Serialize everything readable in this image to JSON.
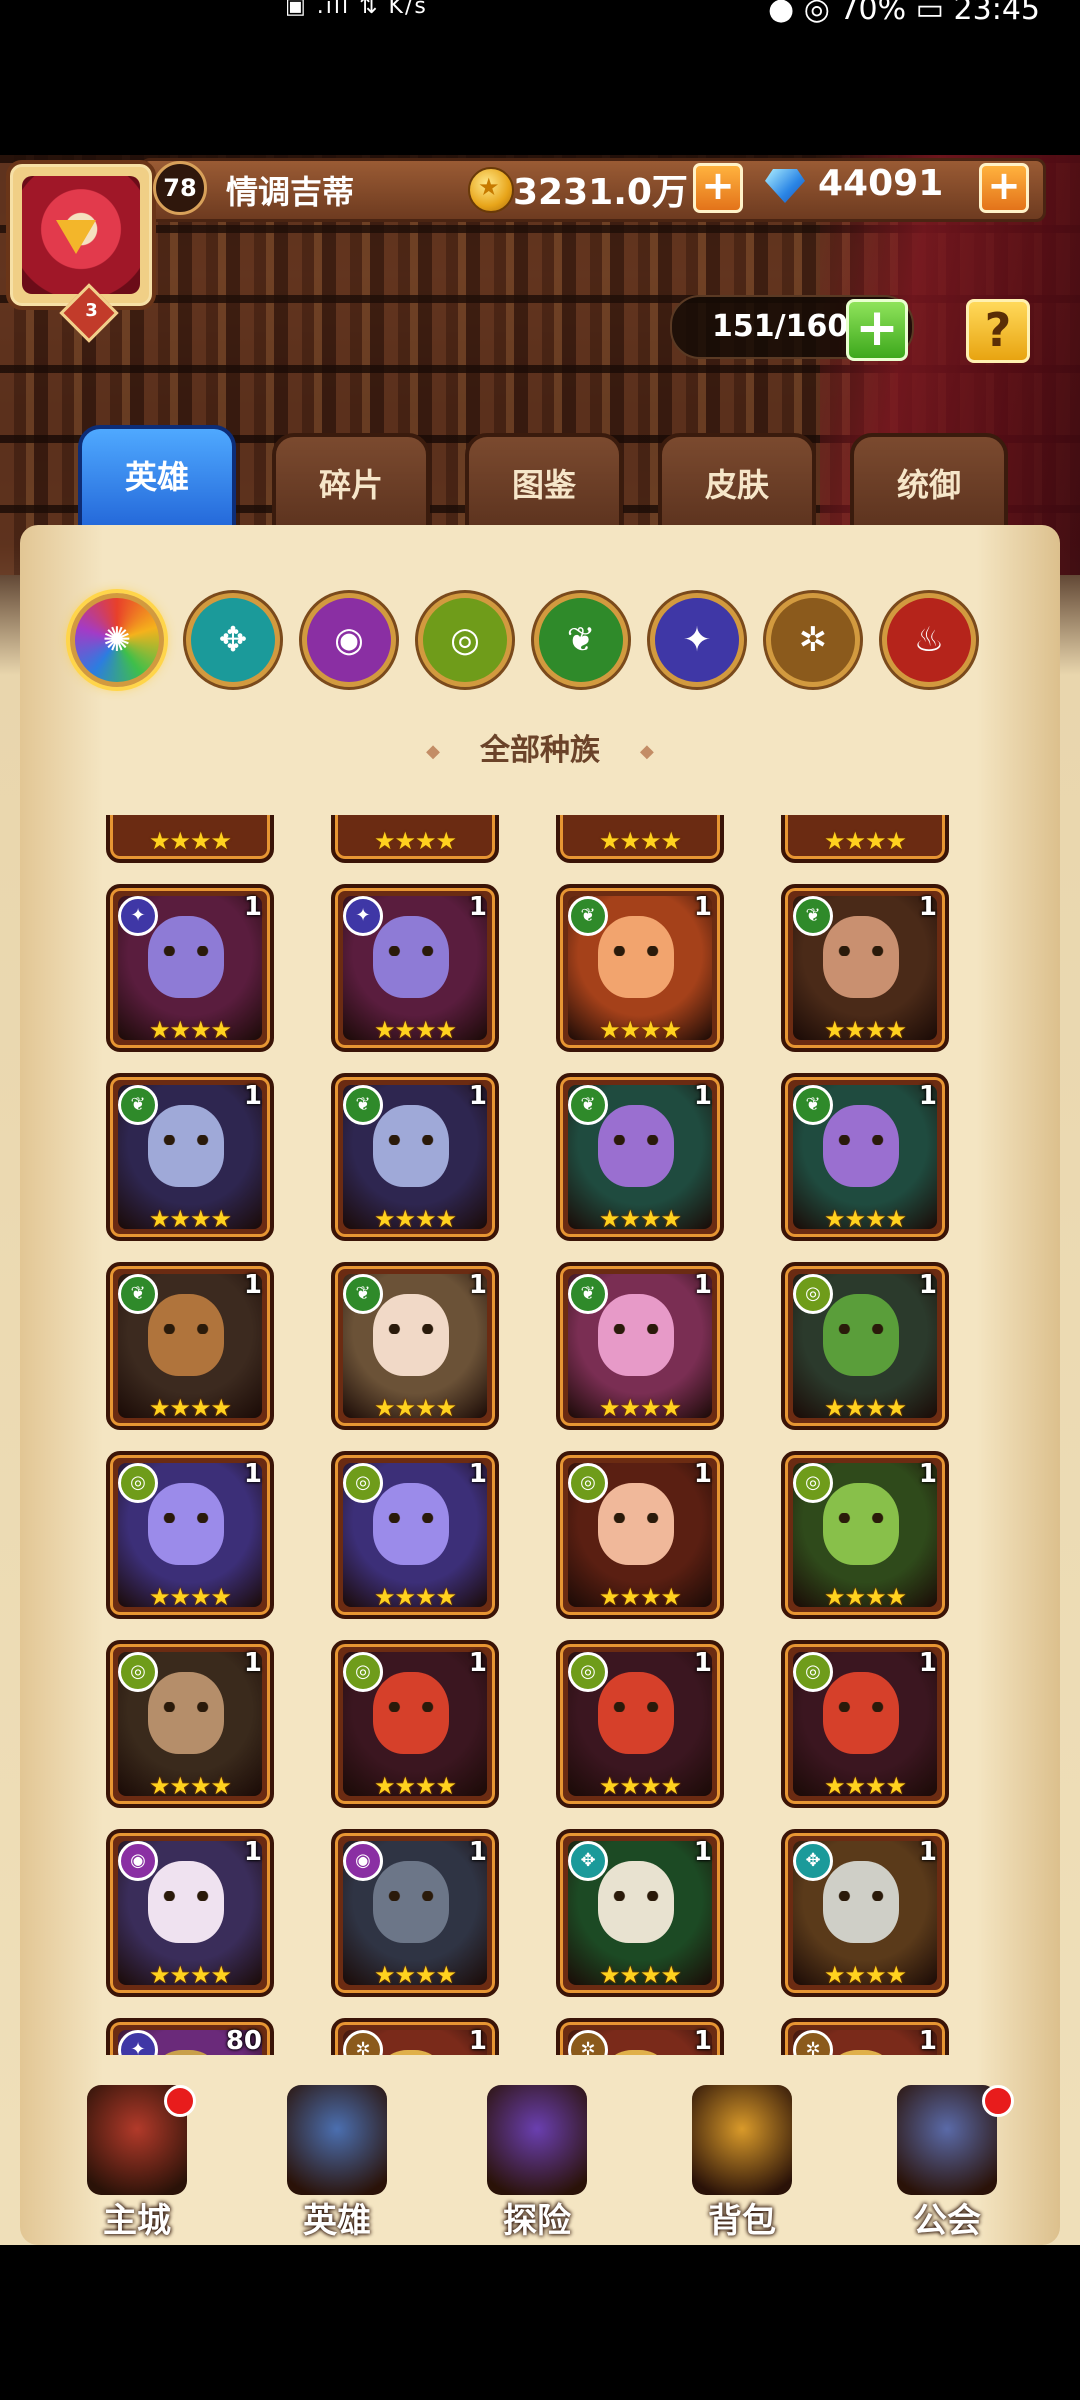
{
  "status_bar": {
    "left": "▣  .ıll  ⇅  K/s",
    "right": "● ◎ 70% ▭ 23:45"
  },
  "player": {
    "level": "78",
    "vip": "3",
    "name": "情调吉蒂",
    "gold": "3231.0万",
    "diamonds": "44091"
  },
  "capacity": "151/160",
  "tabs": [
    "英雄",
    "碎片",
    "图鉴",
    "皮肤",
    "统御"
  ],
  "race_filters": [
    {
      "icon": "all-races-icon",
      "glyph": "✺",
      "color": "#e84b2b"
    },
    {
      "icon": "water-race-icon",
      "glyph": "✥",
      "color": "#1b9a9a"
    },
    {
      "icon": "mystic-race-icon",
      "glyph": "◉",
      "color": "#8a2fa3"
    },
    {
      "icon": "fortress-race-icon",
      "glyph": "◎",
      "color": "#6f9c1a"
    },
    {
      "icon": "forest-race-icon",
      "glyph": "❦",
      "color": "#2f8a2a"
    },
    {
      "icon": "shadow-race-icon",
      "glyph": "✦",
      "color": "#3f37a6"
    },
    {
      "icon": "light-race-icon",
      "glyph": "✲",
      "color": "#8b5a1c"
    },
    {
      "icon": "fire-race-icon",
      "glyph": "♨",
      "color": "#b5241b"
    }
  ],
  "race_title": "全部种族",
  "heroes": [
    {
      "race": "shadow",
      "level": "1",
      "stars": "★★★★",
      "bg": "#5a1d3e",
      "face": "#8e7bd6"
    },
    {
      "race": "shadow",
      "level": "1",
      "stars": "★★★★",
      "bg": "#5a1d3e",
      "face": "#8e7bd6"
    },
    {
      "race": "forest",
      "level": "1",
      "stars": "★★★★",
      "bg": "#a5411a",
      "face": "#f2a46e"
    },
    {
      "race": "forest",
      "level": "1",
      "stars": "★★★★",
      "bg": "#4a2a18",
      "face": "#c99070"
    },
    {
      "race": "forest",
      "level": "1",
      "stars": "★★★★",
      "bg": "#2e2650",
      "face": "#9fa9d8"
    },
    {
      "race": "forest",
      "level": "1",
      "stars": "★★★★",
      "bg": "#2e2650",
      "face": "#9fa9d8"
    },
    {
      "race": "forest",
      "level": "1",
      "stars": "★★★★",
      "bg": "#1f4b3f",
      "face": "#9a6fd0"
    },
    {
      "race": "forest",
      "level": "1",
      "stars": "★★★★",
      "bg": "#1f4b3f",
      "face": "#9a6fd0"
    },
    {
      "race": "forest",
      "level": "1",
      "stars": "★★★★",
      "bg": "#3c2a1f",
      "face": "#b0743c"
    },
    {
      "race": "forest",
      "level": "1",
      "stars": "★★★★",
      "bg": "#6b5237",
      "face": "#f1d9c7"
    },
    {
      "race": "forest",
      "level": "1",
      "stars": "★★★★",
      "bg": "#7a2e53",
      "face": "#e79ac8"
    },
    {
      "race": "fortress",
      "level": "1",
      "stars": "★★★★",
      "bg": "#2b3a2c",
      "face": "#5a9e3a"
    },
    {
      "race": "fortress",
      "level": "1",
      "stars": "★★★★",
      "bg": "#3c2f78",
      "face": "#9b8bea"
    },
    {
      "race": "fortress",
      "level": "1",
      "stars": "★★★★",
      "bg": "#3c2f78",
      "face": "#9b8bea"
    },
    {
      "race": "fortress",
      "level": "1",
      "stars": "★★★★",
      "bg": "#5a1f12",
      "face": "#f0b89a"
    },
    {
      "race": "fortress",
      "level": "1",
      "stars": "★★★★",
      "bg": "#2f4a1b",
      "face": "#88c04a"
    },
    {
      "race": "fortress",
      "level": "1",
      "stars": "★★★★",
      "bg": "#3a2a1c",
      "face": "#b58e6a"
    },
    {
      "race": "fortress",
      "level": "1",
      "stars": "★★★★",
      "bg": "#3b1620",
      "face": "#d6402a"
    },
    {
      "race": "fortress",
      "level": "1",
      "stars": "★★★★",
      "bg": "#3b1620",
      "face": "#d6402a"
    },
    {
      "race": "fortress",
      "level": "1",
      "stars": "★★★★",
      "bg": "#3b1620",
      "face": "#d6402a"
    },
    {
      "race": "mystic",
      "level": "1",
      "stars": "★★★★",
      "bg": "#3a2d5a",
      "face": "#efe2f0"
    },
    {
      "race": "mystic",
      "level": "1",
      "stars": "★★★★",
      "bg": "#2f3444",
      "face": "#6c7688"
    },
    {
      "race": "water",
      "level": "1",
      "stars": "★★★★",
      "bg": "#1c4a24",
      "face": "#e8e2d0"
    },
    {
      "race": "water",
      "level": "1",
      "stars": "★★★★",
      "bg": "#5a3a1a",
      "face": "#cfcfc7"
    },
    {
      "race": "shadow",
      "level": "80",
      "stars": "",
      "bg": "#6a2a7a",
      "face": "#c9a04a"
    },
    {
      "race": "light",
      "level": "1",
      "stars": "",
      "bg": "#7a2a1a",
      "face": "#e0b04a"
    },
    {
      "race": "light",
      "level": "1",
      "stars": "",
      "bg": "#7a2a1a",
      "face": "#e0b04a"
    },
    {
      "race": "light",
      "level": "1",
      "stars": "",
      "bg": "#7a2a1a",
      "face": "#e0b04a"
    }
  ],
  "partial_top_row_stars": [
    "★★★★",
    "★★★★",
    "★★★★",
    "★★★★"
  ],
  "race_badges": {
    "shadow": {
      "glyph": "✦",
      "color": "#3f37a6"
    },
    "forest": {
      "glyph": "❦",
      "color": "#2f8a2a"
    },
    "fortress": {
      "glyph": "◎",
      "color": "#6f9c1a"
    },
    "mystic": {
      "glyph": "◉",
      "color": "#8a2fa3"
    },
    "water": {
      "glyph": "✥",
      "color": "#1b9a9a"
    },
    "light": {
      "glyph": "✲",
      "color": "#8b5a1c"
    }
  },
  "bottom_nav": [
    {
      "label": "主城",
      "icon": "castle-icon",
      "color": "#b23a2a",
      "dot": true
    },
    {
      "label": "英雄",
      "icon": "hero-icon",
      "color": "#4b6fb0",
      "dot": false
    },
    {
      "label": "探险",
      "icon": "portal-icon",
      "color": "#6a3fb0",
      "dot": false
    },
    {
      "label": "背包",
      "icon": "backpack-icon",
      "color": "#d99a2a",
      "dot": false
    },
    {
      "label": "公会",
      "icon": "guild-icon",
      "color": "#5a6aa8",
      "dot": true
    }
  ]
}
